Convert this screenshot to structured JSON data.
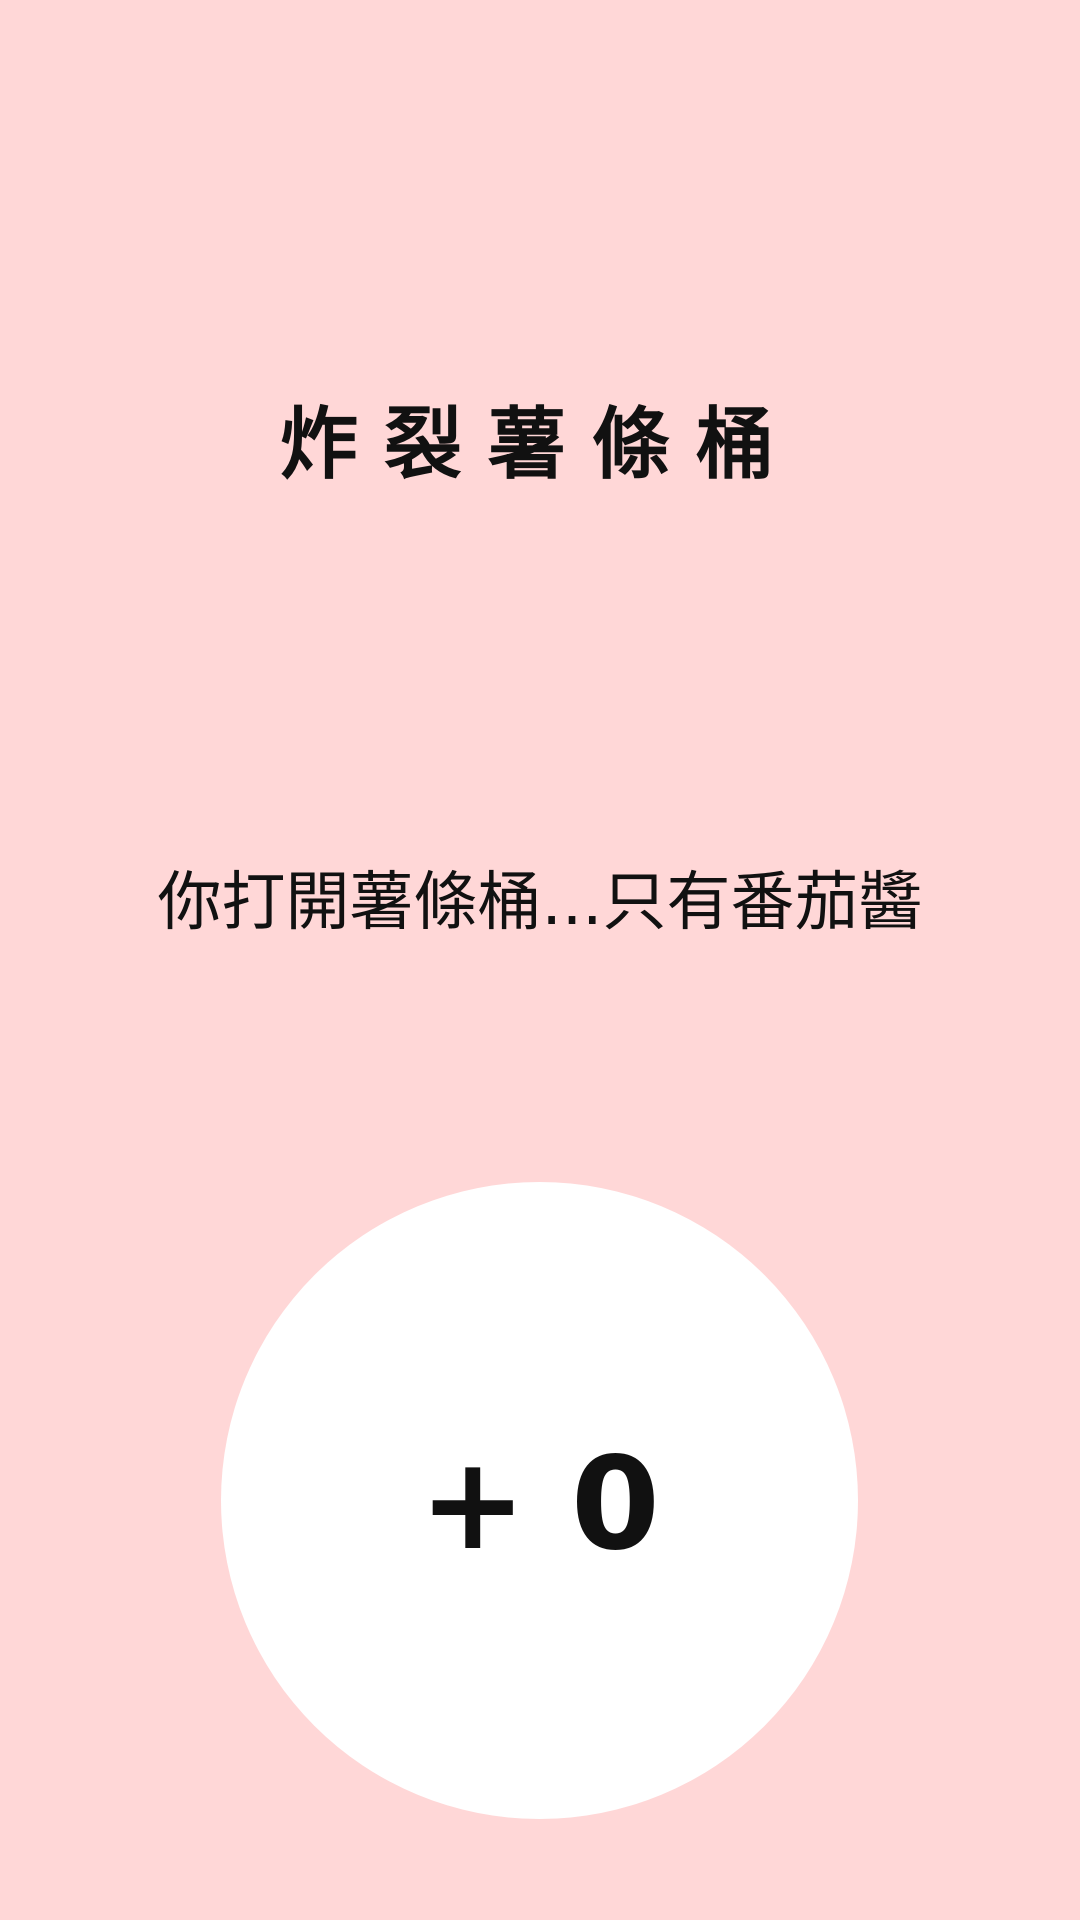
{
  "title": "炸裂薯條桶",
  "message": "你打開薯條桶...只有番茄醬",
  "score": {
    "label": "+ 0",
    "value": 0
  },
  "colors": {
    "background": "#ffd7d7",
    "button": "#ffffff",
    "text": "#111111"
  }
}
